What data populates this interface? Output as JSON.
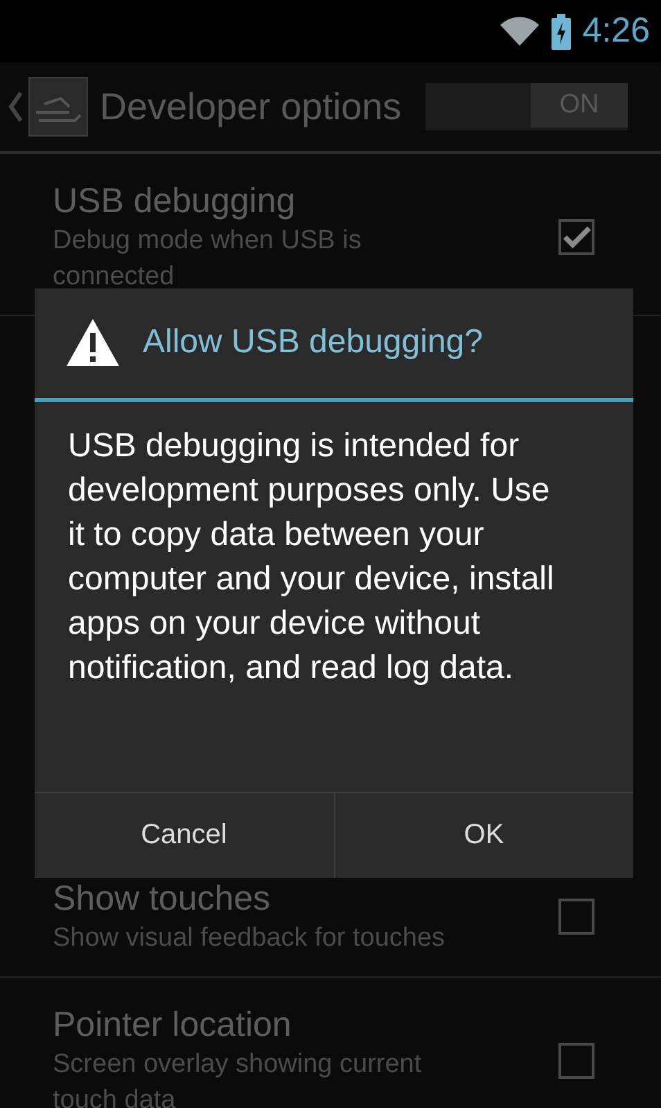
{
  "status_bar": {
    "time": "4:26"
  },
  "action_bar": {
    "title": "Developer options",
    "switch": {
      "label": "ON",
      "on": true
    }
  },
  "settings": [
    {
      "title": "USB debugging",
      "summary": "Debug mode when USB is connected",
      "checked": true
    },
    {
      "title": "Show touches",
      "summary": "Show visual feedback for touches",
      "checked": false
    },
    {
      "title": "Pointer location",
      "summary": "Screen overlay showing current touch data",
      "checked": false
    }
  ],
  "dialog": {
    "title": "Allow USB debugging?",
    "message": "USB debugging is intended for development purposes only. Use it to copy data between your computer and your device, install apps on your device without notification, and read log data.",
    "buttons": [
      "Cancel",
      "OK"
    ]
  }
}
